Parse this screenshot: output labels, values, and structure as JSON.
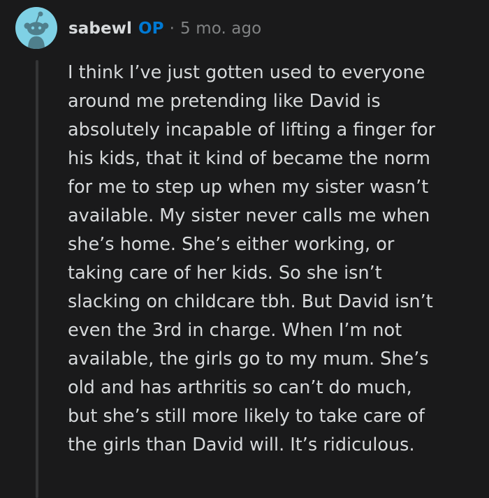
{
  "comment": {
    "author": "sabewl",
    "op_badge": "OP",
    "separator": "·",
    "timestamp": "5 mo. ago",
    "avatar_icon": "reddit-snoo-icon",
    "colors": {
      "background": "#1a1a1b",
      "text": "#d7dadc",
      "op_badge": "#0079d3",
      "meta": "#818384",
      "avatar_bg": "#7fd1e5",
      "thread_line": "#343536"
    },
    "body_lines": [
      "I think I’ve just gotten used to everyone",
      "around me pretending like David is",
      "absolutely incapable of lifting a finger for",
      "his kids, that it kind of became the norm",
      "for me to step up when my sister wasn’t",
      "available. My sister never calls me when",
      "she’s home. She’s either working, or",
      "taking care of her kids. So she isn’t",
      "slacking on childcare tbh. But David isn’t",
      "even the 3rd in charge. When I’m not",
      "available, the girls go to my mum. She’s",
      "old and has arthritis so can’t do much,",
      "but she’s still more likely to take care of",
      "the girls than David will. It’s ridiculous."
    ]
  }
}
